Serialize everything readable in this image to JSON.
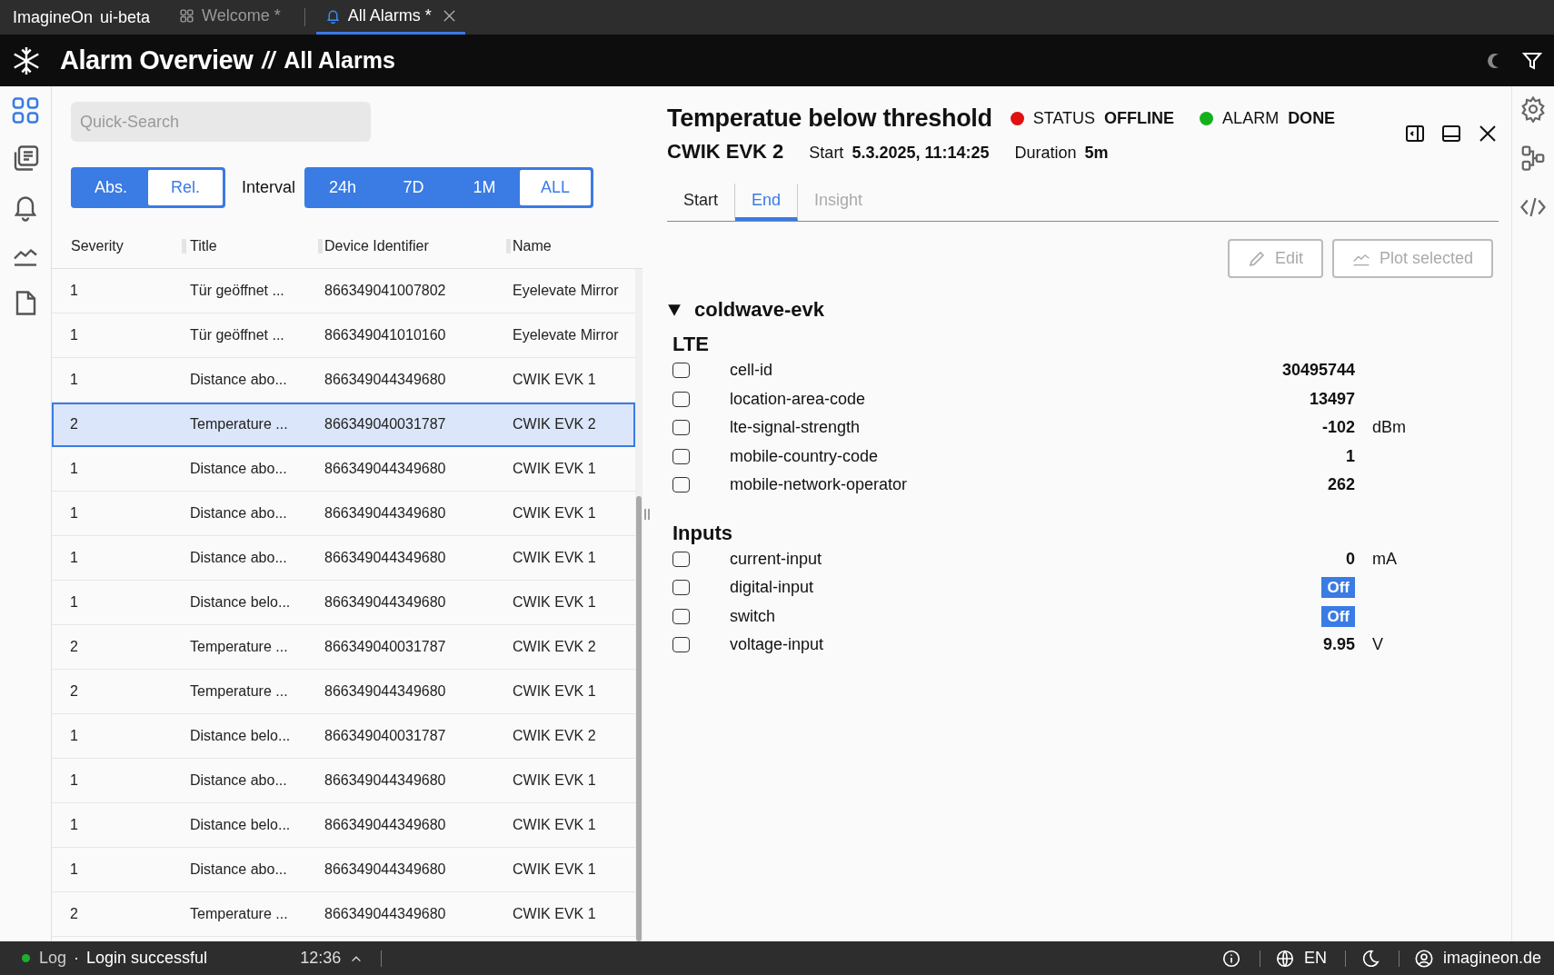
{
  "app": {
    "name": "ImagineOn",
    "variant": "ui-beta"
  },
  "tabs": [
    {
      "label": "Welcome *",
      "kind": "grid",
      "selected": false
    },
    {
      "label": "All Alarms *",
      "kind": "bell",
      "selected": true
    }
  ],
  "header": {
    "title": "Alarm Overview",
    "separator": "//",
    "subtitle": "All Alarms"
  },
  "rail": [
    {
      "kind": "grid",
      "selected": true
    },
    {
      "kind": "docs",
      "selected": false
    },
    {
      "kind": "bell",
      "selected": false
    },
    {
      "kind": "chart",
      "selected": false
    },
    {
      "kind": "file",
      "selected": false
    }
  ],
  "search": {
    "placeholder": "Quick-Search"
  },
  "mode_toggle": [
    {
      "label": "Abs.",
      "selected": false
    },
    {
      "label": "Rel.",
      "selected": true
    }
  ],
  "interval": {
    "label": "Interval",
    "options": [
      {
        "label": "24h",
        "selected": false
      },
      {
        "label": "7D",
        "selected": false
      },
      {
        "label": "1M",
        "selected": false
      },
      {
        "label": "ALL",
        "selected": true
      }
    ]
  },
  "table": {
    "columns": [
      "Severity",
      "Title",
      "Device Identifier",
      "Name"
    ],
    "rows": [
      {
        "cells": [
          "1",
          "Tür geöffnet ...",
          "866349041007802",
          "Eyelevate Mirror"
        ],
        "selected": false
      },
      {
        "cells": [
          "1",
          "Tür geöffnet ...",
          "866349041010160",
          "Eyelevate Mirror"
        ],
        "selected": false
      },
      {
        "cells": [
          "1",
          "Distance abo...",
          "866349044349680",
          "CWIK EVK 1"
        ],
        "selected": false
      },
      {
        "cells": [
          "2",
          "Temperature ...",
          "866349040031787",
          "CWIK EVK 2"
        ],
        "selected": true
      },
      {
        "cells": [
          "1",
          "Distance abo...",
          "866349044349680",
          "CWIK EVK 1"
        ],
        "selected": false
      },
      {
        "cells": [
          "1",
          "Distance abo...",
          "866349044349680",
          "CWIK EVK 1"
        ],
        "selected": false
      },
      {
        "cells": [
          "1",
          "Distance abo...",
          "866349044349680",
          "CWIK EVK 1"
        ],
        "selected": false
      },
      {
        "cells": [
          "1",
          "Distance belo...",
          "866349044349680",
          "CWIK EVK 1"
        ],
        "selected": false
      },
      {
        "cells": [
          "2",
          "Temperature ...",
          "866349040031787",
          "CWIK EVK 2"
        ],
        "selected": false
      },
      {
        "cells": [
          "2",
          "Temperature ...",
          "866349044349680",
          "CWIK EVK 1"
        ],
        "selected": false
      },
      {
        "cells": [
          "1",
          "Distance belo...",
          "866349040031787",
          "CWIK EVK 2"
        ],
        "selected": false
      },
      {
        "cells": [
          "1",
          "Distance abo...",
          "866349044349680",
          "CWIK EVK 1"
        ],
        "selected": false
      },
      {
        "cells": [
          "1",
          "Distance belo...",
          "866349044349680",
          "CWIK EVK 1"
        ],
        "selected": false
      },
      {
        "cells": [
          "1",
          "Distance abo...",
          "866349044349680",
          "CWIK EVK 1"
        ],
        "selected": false
      },
      {
        "cells": [
          "2",
          "Temperature ...",
          "866349044349680",
          "CWIK EVK 1"
        ],
        "selected": false
      }
    ]
  },
  "detail": {
    "title": "Temperatue below threshold",
    "badges": [
      {
        "label": "STATUS",
        "value": "OFFLINE",
        "color": "#e01010"
      },
      {
        "label": "ALARM",
        "value": "DONE",
        "color": "#14b01c"
      }
    ],
    "device": "CWIK EVK 2",
    "start_label": "Start",
    "start": "5.3.2025, 11:14:25",
    "duration_label": "Duration",
    "duration": "5m",
    "tabs": [
      {
        "label": "Start",
        "selected": false,
        "disabled": false
      },
      {
        "label": "End",
        "selected": true,
        "disabled": false
      },
      {
        "label": "Insight",
        "selected": false,
        "disabled": true
      }
    ],
    "buttons": [
      {
        "label": "Edit",
        "kind": "edit",
        "disabled": true
      },
      {
        "label": "Plot selected",
        "kind": "plot",
        "disabled": true
      }
    ],
    "tree": {
      "label": "coldwave-evk",
      "expanded": true,
      "groups": [
        {
          "title": "LTE",
          "items": [
            {
              "label": "cell-id",
              "value": "30495744",
              "kind": "number",
              "checked": false
            },
            {
              "label": "location-area-code",
              "value": "13497",
              "kind": "number",
              "checked": false
            },
            {
              "label": "lte-signal-strength",
              "value": "-102",
              "unit": "dBm",
              "kind": "number",
              "checked": false
            },
            {
              "label": "mobile-country-code",
              "value": "1",
              "kind": "number",
              "checked": false
            },
            {
              "label": "mobile-network-operator",
              "value": "262",
              "kind": "number",
              "checked": false
            }
          ]
        },
        {
          "title": "Inputs",
          "items": [
            {
              "label": "current-input",
              "value": "0",
              "unit": "mA",
              "kind": "number",
              "checked": false
            },
            {
              "label": "digital-input",
              "value": "Off",
              "kind": "toggle",
              "checked": false
            },
            {
              "label": "switch",
              "value": "Off",
              "kind": "toggle",
              "checked": false
            },
            {
              "label": "voltage-input",
              "value": "9.95",
              "unit": "V",
              "kind": "number",
              "checked": false
            }
          ]
        }
      ]
    }
  },
  "status_bar": {
    "log": "Log",
    "dot": "·",
    "message": "Login successful",
    "time": "12:36",
    "language": "EN",
    "user": "imagineon.de"
  }
}
